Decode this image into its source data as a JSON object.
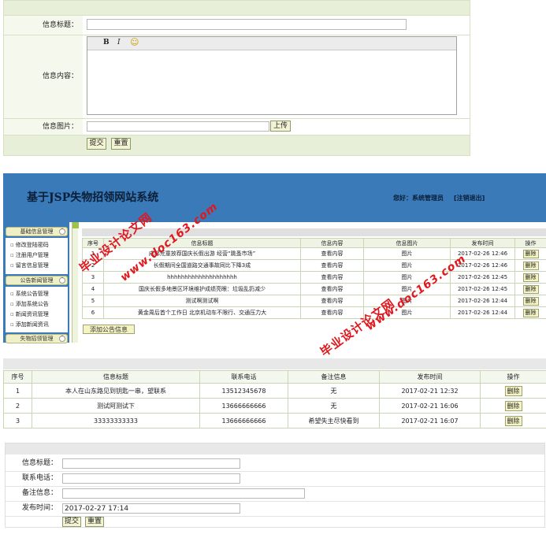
{
  "panel_info_form": {
    "title_label": "信息标题：",
    "content_label": "信息内容：",
    "image_label": "信息图片：",
    "editor_buttons": [
      "B",
      "I",
      "☺"
    ],
    "upload_button": "上传",
    "submit_button": "提交",
    "reset_button": "重置"
  },
  "admin": {
    "site_title": "基于JSP失物招领网站系统",
    "user_greeting": "您好：系统管理员",
    "logout": "[注销退出]",
    "sidebar": {
      "group1": {
        "title": "基础信息管理",
        "items": [
          "修改登陆密码",
          "注册用户管理",
          "留言信息管理"
        ]
      },
      "group2": {
        "title": "公告新闻管理",
        "items": [
          "系统公告管理",
          "添加系统公告",
          "新闻资讯管理",
          "添加新闻资讯"
        ]
      },
      "group3": {
        "title": "失物招领管理"
      }
    },
    "table": {
      "headers": [
        "序号",
        "信息标题",
        "信息内容",
        "信息图片",
        "发布时间",
        "操作"
      ],
      "rows": [
        {
          "no": "1",
          "title": "成都荒童放荐国庆长假出游 经营“跳蚤市场”",
          "content": "查看内容",
          "image": "图片",
          "time": "2017-02-26 12:46",
          "action": "删除"
        },
        {
          "no": "2",
          "title": "长假期间全国道路交通事故同比下降3成",
          "content": "查看内容",
          "image": "图片",
          "time": "2017-02-26 12:46",
          "action": "删除"
        },
        {
          "no": "3",
          "title": "hhhhhhhhhhhhhhhhhhhh",
          "content": "查看内容",
          "image": "图片",
          "time": "2017-02-26 12:45",
          "action": "删除"
        },
        {
          "no": "4",
          "title": "国庆长假多地景区环境维护成绩亮眼：垃圾乱扔减少",
          "content": "查看内容",
          "image": "图片",
          "time": "2017-02-26 12:45",
          "action": "删除"
        },
        {
          "no": "5",
          "title": "测试啊测试啊",
          "content": "查看内容",
          "image": "图片",
          "time": "2017-02-26 12:44",
          "action": "删除"
        },
        {
          "no": "6",
          "title": "黄金周后首个工作日 北京机动车不限行、交通压力大",
          "content": "查看内容",
          "image": "图片",
          "time": "2017-02-26 12:44",
          "action": "删除"
        }
      ]
    },
    "add_button": "添加公告信息"
  },
  "lost_table": {
    "headers": [
      "序号",
      "信息标题",
      "联系电话",
      "备注信息",
      "发布时间",
      "操作"
    ],
    "rows": [
      {
        "no": "1",
        "title": "本人在山东路见到钥匙一串，望联系",
        "phone": "13512345678",
        "note": "无",
        "time": "2017-02-21 12:32",
        "action": "删除"
      },
      {
        "no": "2",
        "title": "测试阿测试下",
        "phone": "13666666666",
        "note": "无",
        "time": "2017-02-21 16:06",
        "action": "删除"
      },
      {
        "no": "3",
        "title": "33333333333",
        "phone": "13666666666",
        "note": "希望失主尽快看到",
        "time": "2017-02-21 16:07",
        "action": "删除"
      }
    ]
  },
  "lost_form": {
    "title_label": "信息标题：",
    "phone_label": "联系电话：",
    "note_label": "备注信息：",
    "time_label": "发布时间：",
    "time_value": "2017-02-27 17:14",
    "submit_button": "提交",
    "reset_button": "重置"
  },
  "watermark": {
    "line1": "毕业设计论文网",
    "line2": "www.doc163.com"
  },
  "colors": {
    "header_blue": "#3a7ab8",
    "form_green": "#e8efd8",
    "watermark_red": "#e0181e"
  }
}
